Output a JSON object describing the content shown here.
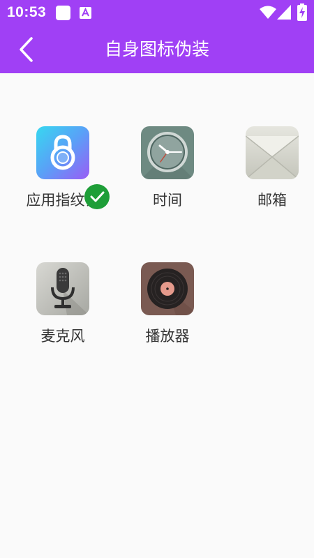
{
  "status_bar": {
    "time": "10:53",
    "icons": [
      "square-notification-icon",
      "a-notification-icon",
      "wifi-icon",
      "cellular-signal-icon",
      "battery-charging-icon"
    ]
  },
  "app_bar": {
    "title": "自身图标伪装",
    "back_icon": "chevron-left-icon"
  },
  "colors": {
    "primary": "#a040f5",
    "background": "#fafafa",
    "selected_badge": "#1e9e38",
    "label": "#333333"
  },
  "icons": [
    {
      "label": "应用指纹锁",
      "icon": "fingerprint-lock-icon",
      "selected": true
    },
    {
      "label": "时间",
      "icon": "clock-icon",
      "selected": false
    },
    {
      "label": "邮箱",
      "icon": "envelope-icon",
      "selected": false
    },
    {
      "label": "麦克风",
      "icon": "microphone-icon",
      "selected": false
    },
    {
      "label": "播放器",
      "icon": "vinyl-record-icon",
      "selected": false
    }
  ]
}
